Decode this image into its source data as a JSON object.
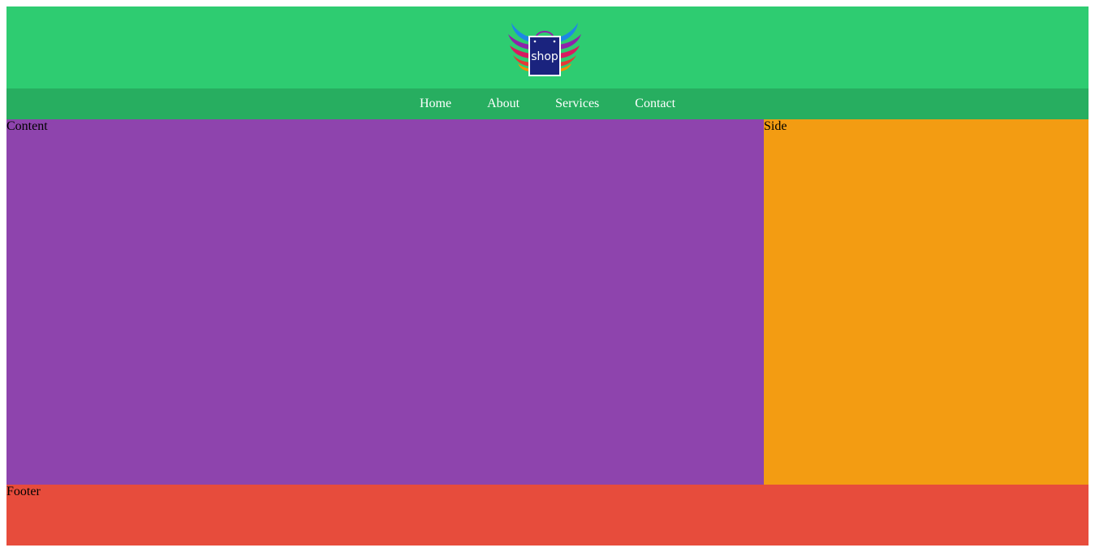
{
  "header": {
    "logo_text": "shop",
    "colors": {
      "background": "#2ecc71"
    }
  },
  "nav": {
    "items": [
      {
        "label": "Home"
      },
      {
        "label": "About"
      },
      {
        "label": "Services"
      },
      {
        "label": "Contact"
      }
    ],
    "colors": {
      "background": "#27ae60",
      "text": "#ffffff"
    }
  },
  "content": {
    "label": "Content",
    "color": "#8e44ad"
  },
  "side": {
    "label": "Side",
    "color": "#f39c12"
  },
  "footer": {
    "label": "Footer",
    "color": "#e74c3c"
  }
}
